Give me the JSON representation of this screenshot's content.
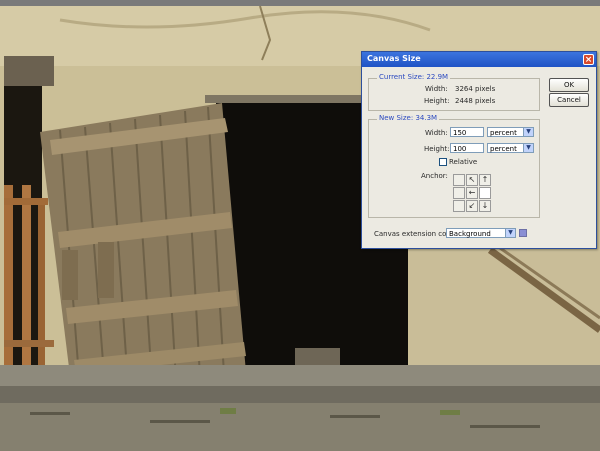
{
  "dialog": {
    "title": "Canvas Size",
    "ok_label": "OK",
    "cancel_label": "Cancel",
    "current_size": {
      "title": "Current Size: 22.9M",
      "width_label": "Width:",
      "width_value": "3264 pixels",
      "height_label": "Height:",
      "height_value": "2448 pixels"
    },
    "new_size": {
      "title": "New Size: 34.3M",
      "width_label": "Width:",
      "width_value": "150",
      "width_unit": "percent",
      "height_label": "Height:",
      "height_value": "100",
      "height_unit": "percent",
      "relative_label": "Relative",
      "anchor_label": "Anchor:"
    },
    "extension_label": "Canvas extension color:",
    "extension_value": "Background",
    "extension_swatch_color": "#8a8fd4"
  },
  "icons": {
    "close": "×",
    "dropdown": "▼",
    "anchor_arrows": [
      "↖",
      "↑",
      "←",
      "↙",
      "↓"
    ]
  }
}
